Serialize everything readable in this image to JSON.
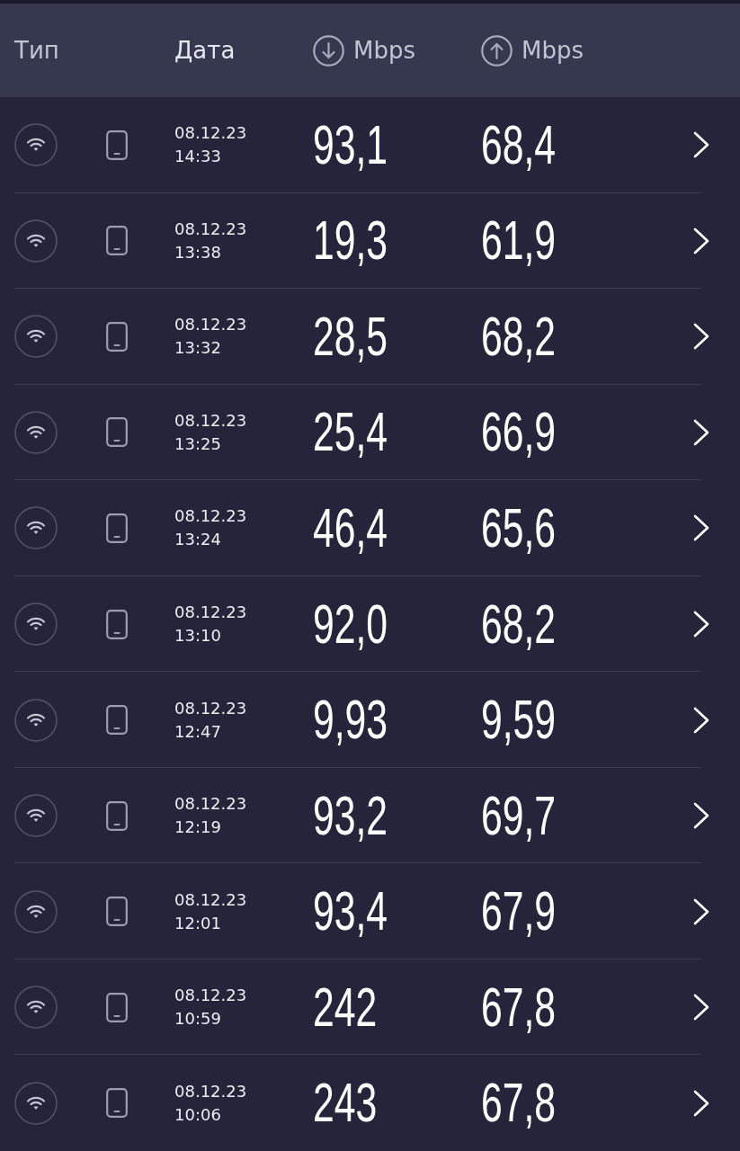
{
  "header": {
    "columns": [
      {
        "kind": "plain",
        "label": "Тип"
      },
      {
        "kind": "plain",
        "label": "Дата"
      },
      {
        "kind": "download",
        "label": "Mbps"
      },
      {
        "kind": "upload",
        "label": "Mbps"
      }
    ]
  },
  "results": [
    {
      "date": "08.12.23",
      "time": "14:33",
      "download": "93,1",
      "upload": "68,4"
    },
    {
      "date": "08.12.23",
      "time": "13:38",
      "download": "19,3",
      "upload": "61,9"
    },
    {
      "date": "08.12.23",
      "time": "13:32",
      "download": "28,5",
      "upload": "68,2"
    },
    {
      "date": "08.12.23",
      "time": "13:25",
      "download": "25,4",
      "upload": "66,9"
    },
    {
      "date": "08.12.23",
      "time": "13:24",
      "download": "46,4",
      "upload": "65,6"
    },
    {
      "date": "08.12.23",
      "time": "13:10",
      "download": "92,0",
      "upload": "68,2"
    },
    {
      "date": "08.12.23",
      "time": "12:47",
      "download": "9,93",
      "upload": "9,59"
    },
    {
      "date": "08.12.23",
      "time": "12:19",
      "download": "93,2",
      "upload": "69,7"
    },
    {
      "date": "08.12.23",
      "time": "12:01",
      "download": "93,4",
      "upload": "67,9"
    },
    {
      "date": "08.12.23",
      "time": "10:59",
      "download": "242",
      "upload": "67,8"
    },
    {
      "date": "08.12.23",
      "time": "10:06",
      "download": "243",
      "upload": "67,8"
    }
  ]
}
